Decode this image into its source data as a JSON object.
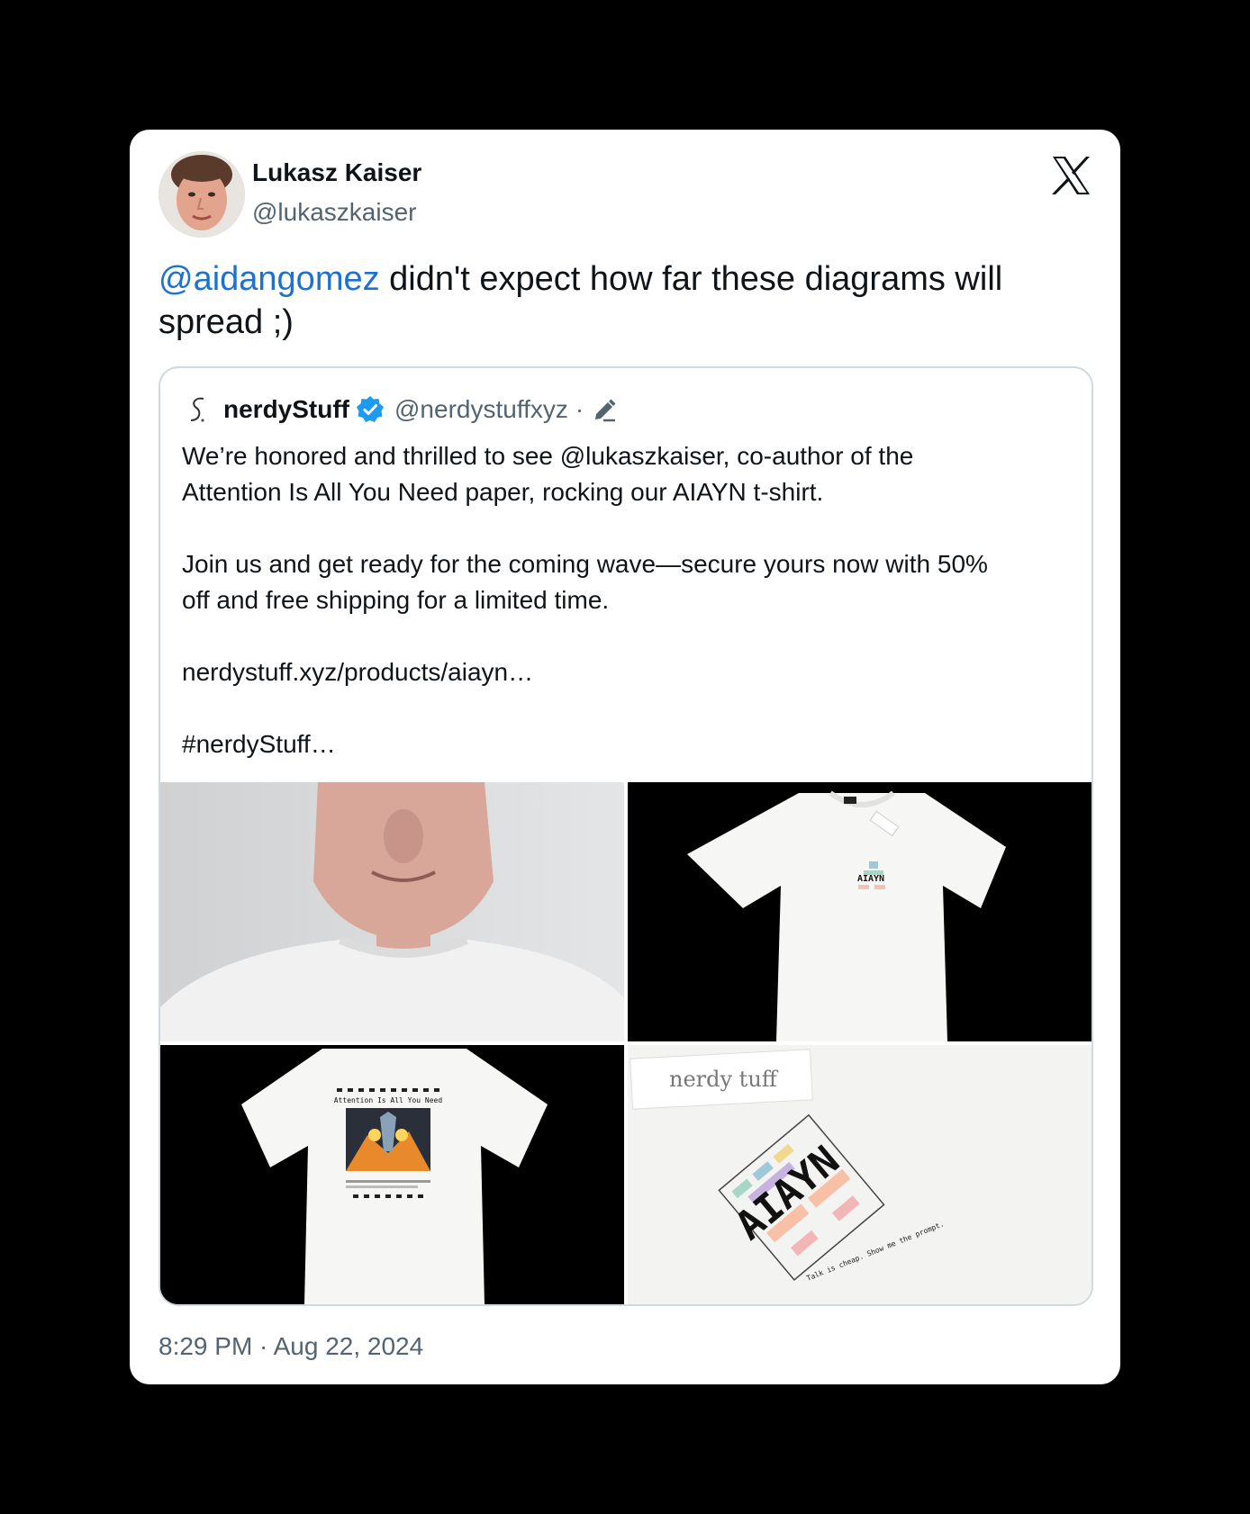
{
  "author": {
    "name": "Lukasz Kaiser",
    "handle": "@lukaszkaiser"
  },
  "tweet": {
    "mention": "@aidangomez",
    "text": " didn't expect how far these diagrams will spread ;)",
    "timestamp": "8:29 PM · Aug 22, 2024"
  },
  "quoted": {
    "name": "nerdyStuff",
    "handle": "@nerdystuffxyz",
    "separator": "·",
    "text": "We’re honored and thrilled to see @lukaszkaiser, co-author of the\nAttention Is All You Need paper, rocking our AIAYN t-shirt.\n\nJoin us and get ready for the coming wave—secure yours now with 50%\noff and free shipping for a limited time.\n\nnerdystuff.xyz/products/aiayn…\n\n#nerdyStuff…",
    "images": {
      "shirt_front_print": "AIAYN",
      "shirt_back_title": "Attention Is All You Need",
      "tag_label": "nerdy tuff",
      "closeup_print": "AIAYN",
      "closeup_slogan": "Talk is cheap. Show me the prompt."
    }
  },
  "icons": {
    "platform": "x-logo-icon",
    "verified": "verified-badge-icon",
    "edited": "edit-pencil-icon"
  },
  "colors": {
    "link": "#1d72d1",
    "verified": "#1d9bf0",
    "muted": "#536471"
  }
}
